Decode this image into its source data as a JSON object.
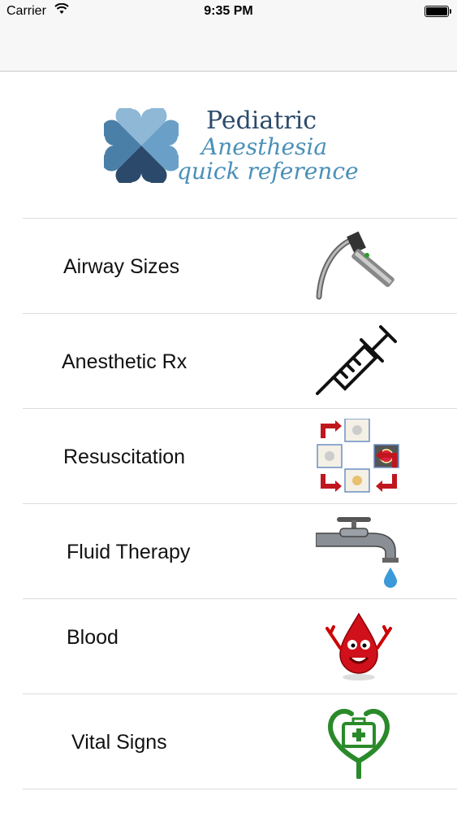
{
  "status": {
    "carrier": "Carrier",
    "time": "9:35 PM"
  },
  "logo": {
    "title": "Pediatric",
    "line2": "Anesthesia",
    "line3": "quick reference",
    "colors": {
      "dark": "#2b4a6b",
      "mid": "#4a7fa8",
      "light": "#8fb8d6",
      "text_blue": "#4a90b8"
    }
  },
  "menu": {
    "items": [
      {
        "label": "Airway Sizes",
        "icon": "laryngoscope-icon"
      },
      {
        "label": "Anesthetic Rx",
        "icon": "syringe-icon"
      },
      {
        "label": "Resuscitation",
        "icon": "cpr-cycle-icon"
      },
      {
        "label": "Fluid Therapy",
        "icon": "faucet-icon"
      },
      {
        "label": "Blood",
        "icon": "blood-drop-icon"
      },
      {
        "label": "Vital Signs",
        "icon": "stethoscope-heart-icon"
      }
    ]
  }
}
